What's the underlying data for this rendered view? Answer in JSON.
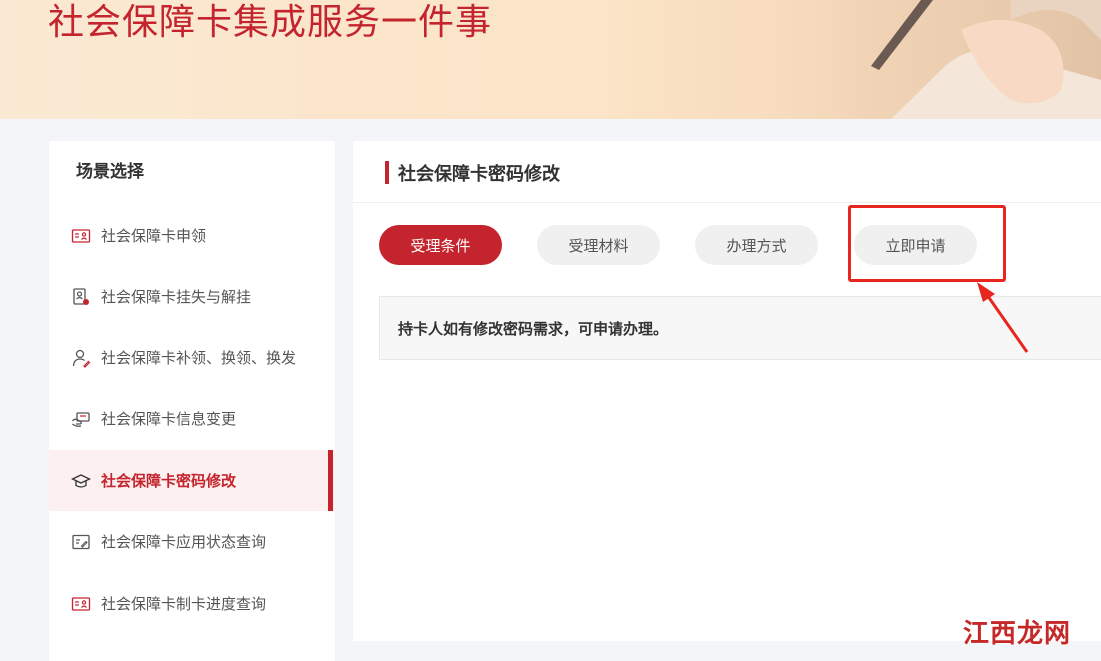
{
  "banner": {
    "title": "社会保障卡集成服务一件事"
  },
  "sidebar": {
    "title": "场景选择",
    "items": [
      {
        "label": "社会保障卡申领",
        "icon": "id-card-icon",
        "active": false
      },
      {
        "label": "社会保障卡挂失与解挂",
        "icon": "card-report-icon",
        "active": false
      },
      {
        "label": "社会保障卡补领、换领、换发",
        "icon": "user-edit-icon",
        "active": false
      },
      {
        "label": "社会保障卡信息变更",
        "icon": "card-hand-icon",
        "active": false
      },
      {
        "label": "社会保障卡密码修改",
        "icon": "graduation-cap-icon",
        "active": true
      },
      {
        "label": "社会保障卡应用状态查询",
        "icon": "document-edit-icon",
        "active": false
      },
      {
        "label": "社会保障卡制卡进度查询",
        "icon": "id-card-icon",
        "active": false
      }
    ]
  },
  "main": {
    "title": "社会保障卡密码修改",
    "tabs": [
      {
        "label": "受理条件",
        "active": true
      },
      {
        "label": "受理材料",
        "active": false
      },
      {
        "label": "办理方式",
        "active": false
      },
      {
        "label": "立即申请",
        "active": false
      }
    ],
    "condition_text": "持卡人如有修改密码需求，可申请办理。"
  },
  "watermark": {
    "text": "江西龙网"
  },
  "colors": {
    "accent": "#c4242e",
    "annotation": "#e8261f"
  }
}
